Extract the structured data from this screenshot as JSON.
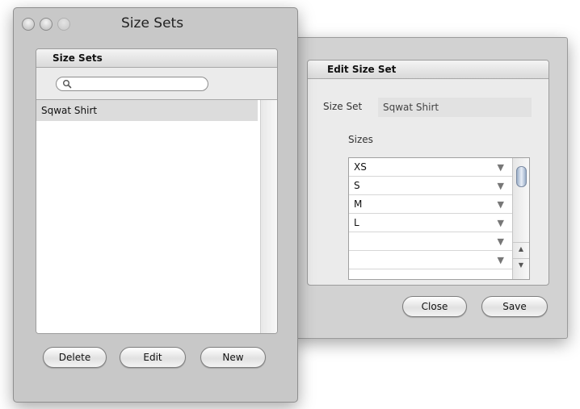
{
  "list_window": {
    "title": "Size Sets",
    "panel_header": "Size Sets",
    "search": {
      "value": "",
      "placeholder": ""
    },
    "items": [
      {
        "label": "Sqwat Shirt"
      }
    ],
    "buttons": {
      "delete": "Delete",
      "edit": "Edit",
      "new": "New"
    }
  },
  "edit_window": {
    "panel_header": "Edit Size Set",
    "size_set_label": "Size Set",
    "size_set_value": "Sqwat Shirt",
    "sizes_label": "Sizes",
    "sizes": [
      "XS",
      "S",
      "M",
      "L",
      "",
      ""
    ],
    "buttons": {
      "close": "Close",
      "save": "Save"
    }
  },
  "icons": {
    "dropdown_arrow": "▼",
    "scroll_up": "▲",
    "scroll_down": "▼"
  }
}
